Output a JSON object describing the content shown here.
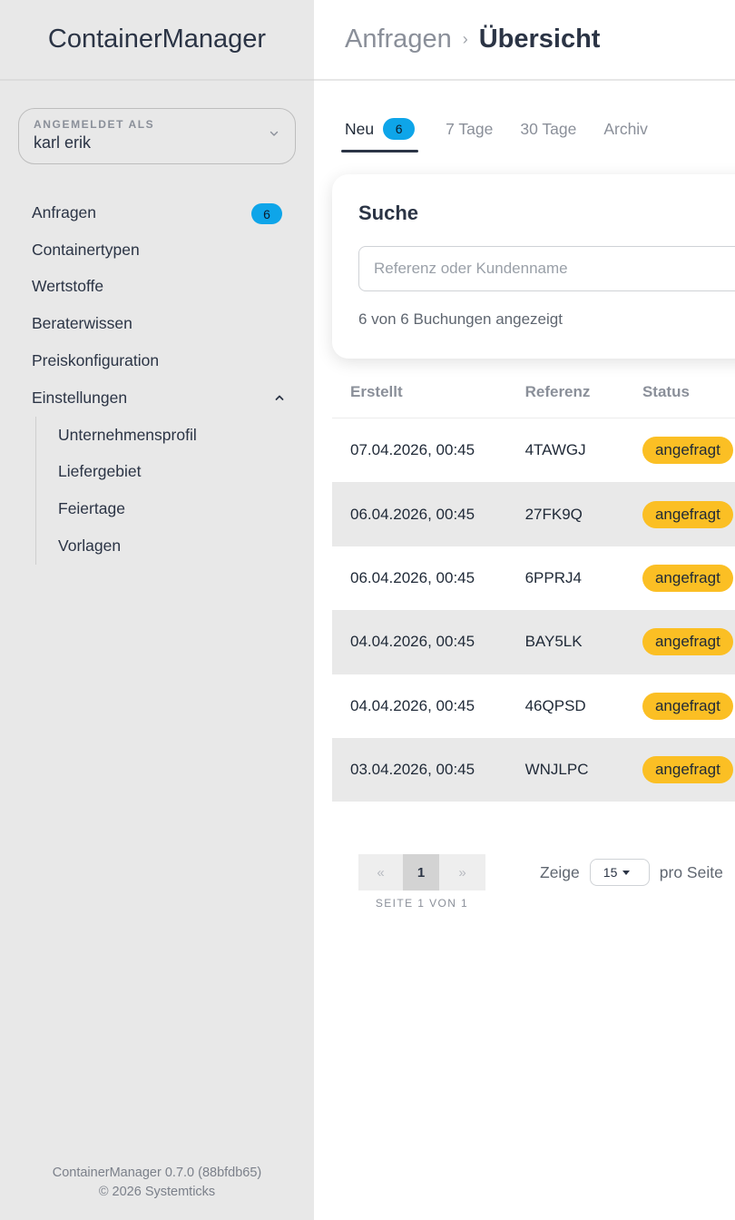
{
  "app": {
    "title": "ContainerManager"
  },
  "user": {
    "caption": "ANGEMELDET ALS",
    "name": "karl erik"
  },
  "nav": {
    "items": [
      {
        "label": "Anfragen",
        "badge": "6"
      },
      {
        "label": "Containertypen"
      },
      {
        "label": "Wertstoffe"
      },
      {
        "label": "Beraterwissen"
      },
      {
        "label": "Preiskonfiguration"
      },
      {
        "label": "Einstellungen"
      }
    ],
    "subitems": [
      {
        "label": "Unternehmensprofil"
      },
      {
        "label": "Liefergebiet"
      },
      {
        "label": "Feiertage"
      },
      {
        "label": "Vorlagen"
      }
    ]
  },
  "footer": {
    "version": "ContainerManager 0.7.0 (88bfdb65)",
    "copyright": "© 2026 Systemticks"
  },
  "breadcrumb": {
    "parent": "Anfragen",
    "separator": "›",
    "current": "Übersicht"
  },
  "tabs": [
    {
      "label": "Neu",
      "badge": "6",
      "active": true
    },
    {
      "label": "7 Tage"
    },
    {
      "label": "30 Tage"
    },
    {
      "label": "Archiv"
    }
  ],
  "search": {
    "title": "Suche",
    "placeholder": "Referenz oder Kundenname",
    "value": "",
    "result_count": "6 von 6 Buchungen angezeigt"
  },
  "table": {
    "headers": {
      "created": "Erstellt",
      "reference": "Referenz",
      "status": "Status"
    },
    "rows": [
      {
        "created": "07.04.2026, 00:45",
        "reference": "4TAWGJ",
        "status": "angefragt"
      },
      {
        "created": "06.04.2026, 00:45",
        "reference": "27FK9Q",
        "status": "angefragt"
      },
      {
        "created": "06.04.2026, 00:45",
        "reference": "6PPRJ4",
        "status": "angefragt"
      },
      {
        "created": "04.04.2026, 00:45",
        "reference": "BAY5LK",
        "status": "angefragt"
      },
      {
        "created": "04.04.2026, 00:45",
        "reference": "46QPSD",
        "status": "angefragt"
      },
      {
        "created": "03.04.2026, 00:45",
        "reference": "WNJLPC",
        "status": "angefragt"
      }
    ]
  },
  "pagination": {
    "prev": "«",
    "current": "1",
    "next": "»",
    "info": "SEITE 1 VON 1",
    "per_page_prefix": "Zeige",
    "per_page_value": "15",
    "per_page_suffix": "pro Seite"
  },
  "colors": {
    "sidebar_bg": "#e8e8e8",
    "badge": "#0ea5e9",
    "status_requested": "#fbbf24",
    "alt_row": "#e9e9e9"
  }
}
